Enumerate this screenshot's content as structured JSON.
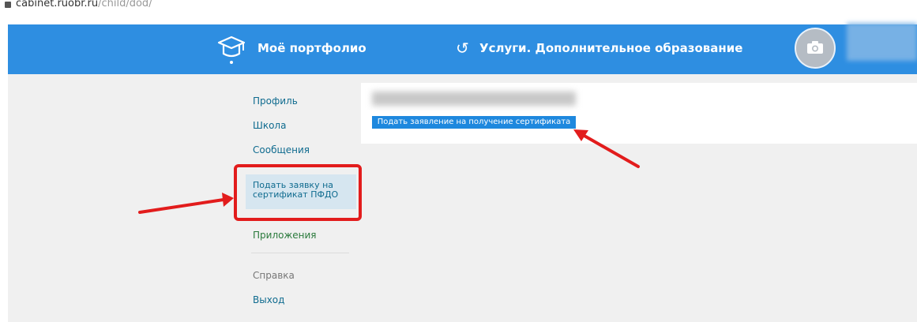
{
  "browser": {
    "url_host": "cabinet.ruobr.ru",
    "url_path": "/child/dod/"
  },
  "header": {
    "brand": "Моё портфолио",
    "service_title": "Услуги. Дополнительное образование"
  },
  "sidebar": {
    "items": [
      {
        "label": "Профиль"
      },
      {
        "label": "Школа"
      },
      {
        "label": "Сообщения"
      },
      {
        "label": "Подать заявку на сертификат ПФДО"
      },
      {
        "label": "Приложения"
      },
      {
        "label": "Справка"
      },
      {
        "label": "Выход"
      }
    ]
  },
  "main": {
    "certificate_button": "Подать заявление на получение сертификата"
  },
  "colors": {
    "header_bg": "#2e8ee1",
    "button_bg": "#1e88de",
    "annotation_red": "#e21c1c",
    "active_item_bg": "#d6e6f0"
  }
}
